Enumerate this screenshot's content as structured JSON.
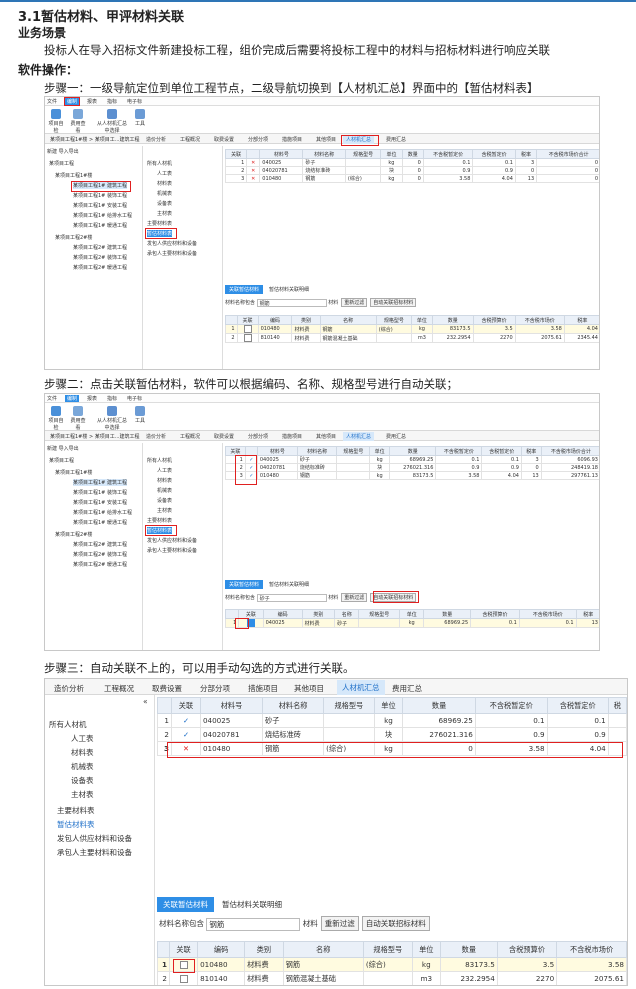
{
  "doc": {
    "title": "3.1暂估材料、甲评材料关联",
    "scenario_head": "业务场景",
    "scenario_text": "投标人在导入招标文件新建投标工程，组价完成后需要将投标工程中的材料与招标材料进行响应关联",
    "ops_head": "软件操作：",
    "step1": "步骤一：一级导航定位到单位工程节点，二级导航切换到【人材机汇总】界面中的【暂估材料表】",
    "step2": "步骤二：点击关联暂估材料，软件可以根据编码、名称、规格型号进行自动关联；",
    "step3": "步骤三：自动关联不上的，可以用手动勾选的方式进行关联。"
  },
  "app": {
    "menu": [
      "文件",
      "编制",
      "报表",
      "指标",
      "电子标"
    ],
    "toolbar": [
      "项目自检",
      "费用查看",
      "从人材机汇总中选择",
      "工具"
    ],
    "project_path": "某项目工程1#楼 > 某项目工...建筑工程",
    "tree_toolbar": [
      "新建",
      "导入导出"
    ],
    "tree": [
      "某项目工程",
      "某项目工程1#楼",
      "某项目工程1# 建筑工程",
      "某项目工程1# 装饰工程",
      "某项目工程1# 安装工程",
      "某项目工程1# 给排水工程",
      "某项目工程1# 暖通工程",
      "某项目工程2#楼",
      "某项目工程2# 建筑工程",
      "某项目工程2# 装饰工程",
      "某项目工程2# 暖通工程"
    ],
    "tabs": [
      "造价分析",
      "工程概况",
      "取费设置",
      "分部分项",
      "措施项目",
      "其他项目",
      "人材机汇总",
      "费用汇总"
    ],
    "mat_tree": [
      "所有人材机",
      "人工表",
      "材料表",
      "机械表",
      "设备表",
      "主材表",
      "主要材料表",
      "暂估材料表",
      "发包人供应材料和设备",
      "承包人主要材料和设备"
    ],
    "grid_headers": [
      "关联",
      "材料号",
      "材料名称",
      "规格型号",
      "单位",
      "数量",
      "不含税暂定价",
      "含税暂定价",
      "税率",
      "不含税市场价合计",
      "含税"
    ],
    "rows": [
      {
        "no": "1",
        "code": "040025",
        "name": "砂子",
        "spec": "",
        "unit": "kg",
        "qty": "68969.25",
        "p1": "0.1",
        "p2": "0.1",
        "tax": "3",
        "sum": "6096.93"
      },
      {
        "no": "2",
        "code": "04020781",
        "name": "烧结标准砖",
        "spec": "",
        "unit": "块",
        "qty": "276021.316",
        "p1": "0.9",
        "p2": "0.9",
        "tax": "0",
        "sum": "248419.18"
      },
      {
        "no": "3",
        "code": "010480",
        "name": "钢筋",
        "spec": "(综合)",
        "unit": "kg",
        "qty": "0",
        "p1": "3.58",
        "p2": "4.04",
        "tax": "13",
        "sum": "0"
      }
    ],
    "rows_s2": [
      {
        "qty": "68969.25",
        "sum": "6096.93"
      },
      {
        "qty": "276021.316",
        "sum": "248419.18"
      },
      {
        "qty": "83173.5",
        "sum": "297761.13"
      }
    ],
    "panel_tabs": [
      "关联暂估材料",
      "暂估材料关联明细"
    ],
    "filter_label": "材料名称包含",
    "filter_value_1": "钢筋",
    "filter_value_2": "砂子",
    "filter_mat": "材料",
    "btn_refilter": "重新过滤",
    "btn_auto": "自动关联招标材料",
    "sub_headers": [
      "关联",
      "编码",
      "类别",
      "名称",
      "规格型号",
      "单位",
      "数量",
      "含税预算价",
      "不含税市场价",
      "税率"
    ],
    "sub_rows": [
      {
        "no": "1",
        "code": "010480",
        "cat": "材料费",
        "name": "钢筋",
        "spec": "(综合)",
        "unit": "kg",
        "qty": "83173.5",
        "p1": "3.5",
        "p2": "3.58",
        "tax": "4.04"
      },
      {
        "no": "2",
        "code": "810140",
        "cat": "材料费",
        "name": "钢筋混凝土基础",
        "spec": "",
        "unit": "m3",
        "qty": "232.2954",
        "p1": "2270",
        "p2": "2075.61",
        "tax": "2345.44"
      }
    ],
    "sub_rows_s2": [
      {
        "no": "1",
        "code": "040025",
        "cat": "材料费",
        "name": "砂子",
        "spec": "",
        "unit": "kg",
        "qty": "68969.25",
        "p1": "0.1",
        "p2": "0.1",
        "tax": "13"
      }
    ]
  }
}
